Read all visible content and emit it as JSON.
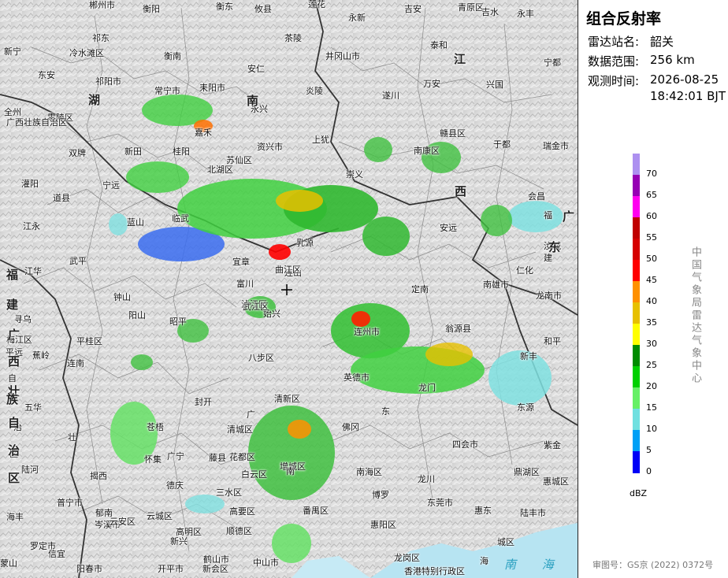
{
  "panel": {
    "title": "组合反射率",
    "station_label": "雷达站名:",
    "station": "韶关",
    "range_label": "数据范围:",
    "range": "256 km",
    "time_label": "观测时间:",
    "date": "2026-08-25",
    "time": "18:42:01 BJT",
    "unit": "dBZ",
    "agency": "中国气象局雷达气象中心",
    "approval": "审图号：GS京 (2022) 0372号"
  },
  "legend": {
    "ticks": [
      "70",
      "65",
      "60",
      "55",
      "50",
      "45",
      "40",
      "35",
      "30",
      "25",
      "20",
      "15",
      "10",
      "5",
      "0"
    ],
    "colors": [
      "#ad90f0",
      "#9600b4",
      "#ff00f0",
      "#c00000",
      "#d60000",
      "#ff0000",
      "#ff9000",
      "#e7c000",
      "#ffff00",
      "#008c00",
      "#00d000",
      "#66f066",
      "#70e0e0",
      "#00a0f6",
      "#0000f6"
    ]
  },
  "map": {
    "places": [
      "郴州市",
      "衡阳",
      "衡东",
      "攸县",
      "莲花",
      "永新",
      "吉安",
      "青原区",
      "吉水",
      "永丰",
      "祁东",
      "茶陵",
      "新宁",
      "冷水滩区",
      "衡南",
      "井冈山市",
      "泰和",
      "江",
      "宁都",
      "东安",
      "祁阳市",
      "安仁",
      "万安",
      "兴国",
      "常宁市",
      "耒阳市",
      "永兴",
      "炎陵",
      "遂川",
      "湖",
      "南",
      "全州",
      "零陵区",
      "赣县区",
      "广西壮族自治区",
      "双牌",
      "嘉禾",
      "资兴市",
      "上犹",
      "于都",
      "瑞金市",
      "新田",
      "桂阳",
      "南康区",
      "灌阳",
      "宁远",
      "苏仙区",
      "崇义",
      "西",
      "道县",
      "会昌",
      "北湖区",
      "江永",
      "蓝山",
      "临武",
      "安远",
      "福",
      "宜章",
      "汝城",
      "建",
      "江华",
      "武平",
      "富川",
      "乳源",
      "仁化",
      "寻乌",
      "钟山",
      "连山",
      "南雄市",
      "定南",
      "阳山",
      "龙南市",
      "平远",
      "昭平",
      "连州市",
      "翁源县",
      "和平",
      "蕉岭",
      "平桂区",
      "八步区",
      "英德市",
      "新丰",
      "梅江区",
      "壮",
      "封开",
      "清新区",
      "佛冈",
      "龙门",
      "东源",
      "五华",
      "苍梧",
      "广宁",
      "四会市",
      "紫金",
      "揭西",
      "德庆",
      "鼎湖区",
      "陆河",
      "藤县",
      "三水区",
      "南海区",
      "博罗",
      "惠城区",
      "普宁市",
      "郁南",
      "高要区",
      "番禺区",
      "东莞市",
      "惠东",
      "海丰",
      "岑溪市",
      "云安区",
      "云城区",
      "高明区",
      "顺德区",
      "惠阳区",
      "陆丰市",
      "罗定市",
      "新兴",
      "鹤山市",
      "中山市",
      "龙岗区",
      "城区",
      "阳春市",
      "开平市",
      "新会区",
      "信宜",
      "香港特别行政区",
      "龙川",
      "蒙山",
      "怀集",
      "始兴",
      "曲江区",
      "浈江区",
      "武江区",
      "广",
      "东",
      "自",
      "治",
      "区",
      "清城区",
      "花都区",
      "白云区",
      "增城区",
      "南",
      "海",
      "连南"
    ],
    "province_labels": [
      "湖",
      "南",
      "江",
      "西",
      "广",
      "东",
      "福",
      "建",
      "广",
      "西",
      "壮",
      "族",
      "自",
      "治",
      "区"
    ],
    "sea_label": "南 海"
  }
}
